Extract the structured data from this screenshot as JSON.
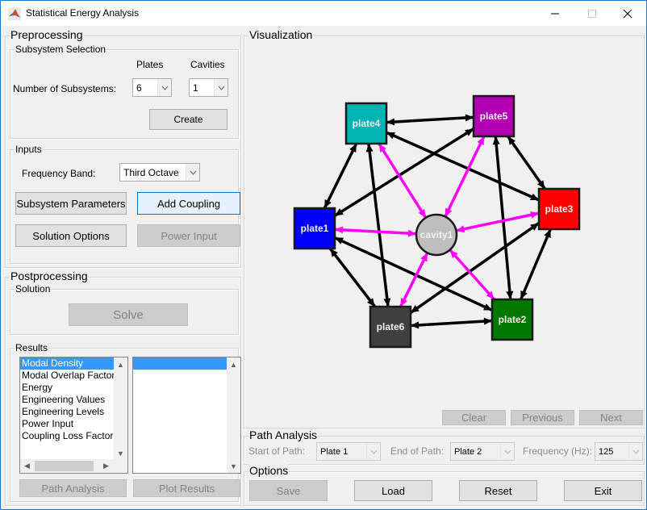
{
  "window": {
    "title": "Statistical Energy Analysis",
    "controls": {
      "minimize": "—",
      "maximize": "☐",
      "close": "✕"
    }
  },
  "preprocessing": {
    "title": "Preprocessing",
    "subsystem_selection": {
      "title": "Subsystem Selection",
      "plates_label": "Plates",
      "cavities_label": "Cavities",
      "number_label": "Number of Subsystems:",
      "plates_value": "6",
      "cavities_value": "1",
      "create_label": "Create"
    },
    "inputs": {
      "title": "Inputs",
      "frequency_band_label": "Frequency Band:",
      "frequency_band_value": "Third Octave",
      "subsystem_parameters_label": "Subsystem Parameters",
      "add_coupling_label": "Add Coupling",
      "solution_options_label": "Solution Options",
      "power_input_label": "Power Input"
    }
  },
  "postprocessing": {
    "title": "Postprocessing",
    "solution": {
      "title": "Solution",
      "solve_label": "Solve"
    },
    "results": {
      "title": "Results",
      "list": [
        "Modal Density",
        "Modal Overlap Factor",
        "Energy",
        "Engineering Values",
        "Engineering Levels",
        "Power Input",
        "Coupling Loss Factor"
      ],
      "selected_index": 0,
      "secondary_list": [
        ""
      ],
      "path_analysis_label": "Path Analysis",
      "plot_results_label": "Plot Results"
    }
  },
  "visualization": {
    "title": "Visualization",
    "nodes": [
      {
        "id": "plate4",
        "label": "plate4",
        "shape": "square",
        "color": "#00b4b4"
      },
      {
        "id": "plate5",
        "label": "plate5",
        "shape": "square",
        "color": "#b400b4"
      },
      {
        "id": "plate3",
        "label": "plate3",
        "shape": "square",
        "color": "#ff0000"
      },
      {
        "id": "plate2",
        "label": "plate2",
        "shape": "square",
        "color": "#007800"
      },
      {
        "id": "plate6",
        "label": "plate6",
        "shape": "square",
        "color": "#404040"
      },
      {
        "id": "plate1",
        "label": "plate1",
        "shape": "square",
        "color": "#0000ff"
      },
      {
        "id": "cavity1",
        "label": "cavity1",
        "shape": "circle",
        "color": "#bebebe"
      }
    ],
    "plate_edges": [
      [
        "plate4",
        "plate5"
      ],
      [
        "plate4",
        "plate1"
      ],
      [
        "plate4",
        "plate3"
      ],
      [
        "plate4",
        "plate6"
      ],
      [
        "plate5",
        "plate1"
      ],
      [
        "plate5",
        "plate3"
      ],
      [
        "plate5",
        "plate2"
      ],
      [
        "plate3",
        "plate2"
      ],
      [
        "plate3",
        "plate6"
      ],
      [
        "plate1",
        "plate2"
      ],
      [
        "plate1",
        "plate6"
      ],
      [
        "plate6",
        "plate2"
      ]
    ],
    "cavity_edges": [
      [
        "cavity1",
        "plate4"
      ],
      [
        "cavity1",
        "plate5"
      ],
      [
        "cavity1",
        "plate3"
      ],
      [
        "cavity1",
        "plate1"
      ],
      [
        "cavity1",
        "plate6"
      ],
      [
        "cavity1",
        "plate2"
      ]
    ],
    "colors": {
      "plate_edge": "#000000",
      "cavity_edge": "#ff00ff"
    },
    "clear_label": "Clear",
    "previous_label": "Previous",
    "next_label": "Next"
  },
  "path_analysis": {
    "title": "Path Analysis",
    "start_label": "Start of Path:",
    "start_value": "Plate 1",
    "end_label": "End of Path:",
    "end_value": "Plate 2",
    "frequency_label": "Frequency (Hz):",
    "frequency_value": "125"
  },
  "options": {
    "title": "Options",
    "save_label": "Save",
    "load_label": "Load",
    "reset_label": "Reset",
    "exit_label": "Exit"
  }
}
